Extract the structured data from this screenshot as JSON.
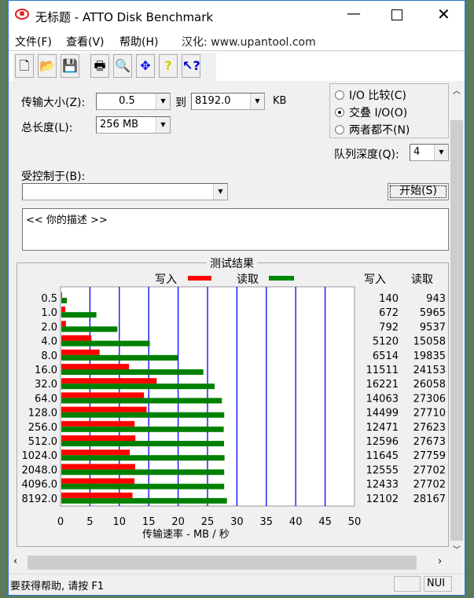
{
  "window": {
    "title": "无标题 - ATTO Disk Benchmark"
  },
  "menu": [
    "文件(F)",
    "查看(V)",
    "帮助(H)",
    "汉化: www.upantool.com"
  ],
  "toolbar": [
    "new",
    "open",
    "save",
    "print",
    "print-preview",
    "move",
    "help",
    "context-help"
  ],
  "settings": {
    "transfer_size_label": "传输大小(Z):",
    "transfer_from": "0.5",
    "to_label": "到",
    "transfer_to": "8192.0",
    "unit": "KB",
    "total_length_label": "总长度(L):",
    "total_length": "256 MB",
    "radio_options": [
      "I/O 比较(C)",
      "交叠 I/O(O)",
      "两者都不(N)"
    ],
    "radio_selected": 1,
    "queue_depth_label": "队列深度(Q):",
    "queue_depth": "4",
    "controlled_by_label": "受控制于(B):",
    "controlled_by": "",
    "start_label": "开始(S)",
    "description": "<<  你的描述  >>"
  },
  "results": {
    "title": "测试结果",
    "write_label": "写入",
    "read_label": "读取",
    "col_write": "写入",
    "col_read": "读取"
  },
  "chart_data": {
    "type": "bar",
    "orientation": "horizontal",
    "xlabel": "传输速率 - MB / 秒",
    "xlim": [
      0,
      50
    ],
    "xticks": [
      "0",
      "5",
      "10",
      "15",
      "20",
      "25",
      "30",
      "35",
      "40",
      "45",
      "50"
    ],
    "categories": [
      "0.5",
      "1.0",
      "2.0",
      "4.0",
      "8.0",
      "16.0",
      "32.0",
      "64.0",
      "128.0",
      "256.0",
      "512.0",
      "1024.0",
      "2048.0",
      "4096.0",
      "8192.0"
    ],
    "series": [
      {
        "name": "写入",
        "color": "#ff0000",
        "values": [
          140,
          672,
          792,
          5120,
          6514,
          11511,
          16221,
          14063,
          14499,
          12471,
          12596,
          11645,
          12555,
          12433,
          12102
        ]
      },
      {
        "name": "读取",
        "color": "#008000",
        "values": [
          943,
          5965,
          9537,
          15058,
          19835,
          24153,
          26058,
          27306,
          27710,
          27623,
          27673,
          27759,
          27702,
          27702,
          28167
        ]
      }
    ],
    "grid": true,
    "gridline_color": "#0000ff"
  },
  "status": {
    "help": "要获得帮助, 请按 F1",
    "num": "NUI"
  }
}
